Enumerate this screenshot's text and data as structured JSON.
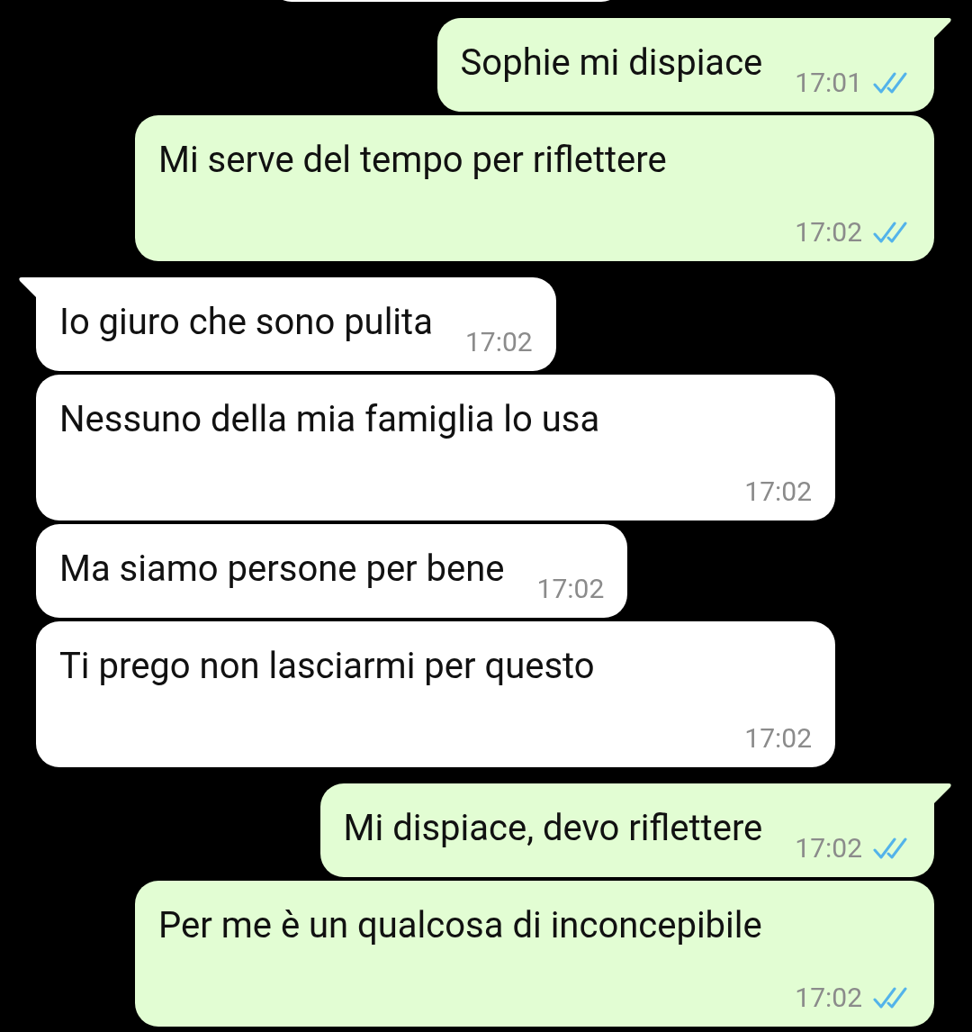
{
  "messages": [
    {
      "outgoing": true,
      "kind": "inline",
      "tail": true,
      "text": "Sophie mi dispiace",
      "time": "17:01",
      "read": true
    },
    {
      "outgoing": true,
      "kind": "stacked",
      "tail": false,
      "text": "Mi serve del tempo per riflettere",
      "time": "17:02",
      "read": true
    },
    {
      "outgoing": false,
      "kind": "inline",
      "tail": true,
      "text": "Io giuro che sono pulita",
      "time": "17:02"
    },
    {
      "outgoing": false,
      "kind": "stacked",
      "tail": false,
      "text": "Nessuno della mia famiglia lo usa",
      "time": "17:02"
    },
    {
      "outgoing": false,
      "kind": "inline",
      "tail": false,
      "text": "Ma siamo persone per bene",
      "time": "17:02"
    },
    {
      "outgoing": false,
      "kind": "stacked",
      "tail": false,
      "text": "Ti prego non lasciarmi per questo",
      "time": "17:02"
    },
    {
      "outgoing": true,
      "kind": "inline",
      "tail": true,
      "text": "Mi dispiace, devo riflettere",
      "time": "17:02",
      "read": true
    },
    {
      "outgoing": true,
      "kind": "stacked",
      "tail": false,
      "text": "Per me è un qualcosa di inconcepibile",
      "time": "17:02",
      "read": true
    }
  ]
}
